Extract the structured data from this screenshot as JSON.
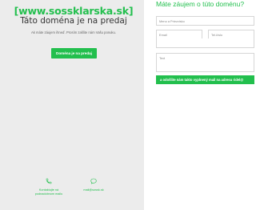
{
  "left": {
    "domain": "[www.sossklarska.sk]",
    "headline": "Táto doména je na predaj",
    "description": "Ak máte záujem ihneď. Prosím zašlite nám Vašu ponuku.",
    "cta_label": "Doména je na predaj",
    "contacts": [
      {
        "icon": "phone-icon",
        "label_line1": "Kontaktujte ná",
        "label_line2": "podnadobnom mailu"
      },
      {
        "icon": "chat-icon",
        "label_line1": "mail@sossk.sk",
        "label_line2": ""
      }
    ]
  },
  "form": {
    "title": "Máte záujem o túto doménu?",
    "name_placeholder": "Meno a Priezvisko",
    "email_placeholder": "Email",
    "phone_placeholder": "Tel.číslo",
    "text_placeholder": "Text",
    "submit_label": "a odošlite nám takto vyplnený mail na adresu ridel@",
    "accent": "#22bf4d"
  }
}
